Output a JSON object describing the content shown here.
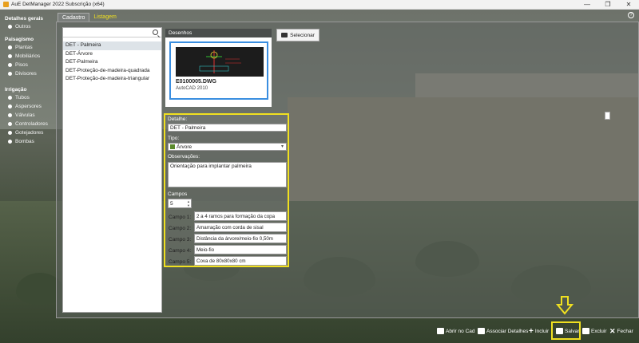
{
  "window": {
    "title": "AuE DetManager 2022 Subscrição (x64)",
    "minimize": "—",
    "maximize": "❐",
    "close": "✕"
  },
  "help": "?",
  "sidebar": {
    "sections": [
      {
        "title": "Detalhes gerais",
        "items": [
          "Outros"
        ]
      },
      {
        "title": "Paisagismo",
        "items": [
          "Plantas",
          "Mobiliários",
          "Pisos",
          "Divisores"
        ]
      },
      {
        "title": "Irrigação",
        "items": [
          "Tubos",
          "Aspersores",
          "Válvulas",
          "Controladores",
          "Gotejadores",
          "Bombas"
        ]
      }
    ],
    "selected": "Plantas"
  },
  "tabs": [
    {
      "label": "Cadastro",
      "active": true
    },
    {
      "label": "Listagem",
      "active": false
    }
  ],
  "list": {
    "items": [
      "DET - Palmeira",
      "DET-Árvore",
      "DET-Palmeira",
      "DET-Proteção-de-madeira-quadrada",
      "DET-Proteção-de-madeira-triangular"
    ],
    "selected_index": 0
  },
  "drawings": {
    "label": "Desenhos",
    "file_name": "E0100005.DWG",
    "file_version": "AutoCAD 2010",
    "select_button": "Selecionar"
  },
  "form": {
    "detalhe_label": "Detalhe:",
    "detalhe_value": "DET - Palmeira",
    "tipo_label": "Tipo:",
    "tipo_value": "Árvore",
    "observacoes_label": "Observações:",
    "observacoes_value": "Orientação para implantar palmeira",
    "campos_label": "Campos",
    "campos_value": "5",
    "campos": [
      {
        "label": "Campo 1:",
        "value": "2 a 4 ramos para formação da copa"
      },
      {
        "label": "Campo 2:",
        "value": "Amarração com corda de sisal"
      },
      {
        "label": "Campo 3:",
        "value": "Distância da árvore/meio-fio 0,50m"
      },
      {
        "label": "Campo 4:",
        "value": "Meio-fio"
      },
      {
        "label": "Campo 5:",
        "value": "Cova de 80x80x80 cm"
      }
    ]
  },
  "bottom_buttons": {
    "abrir": "Abrir no Cad",
    "associar": "Associar Detalhes",
    "incluir": "Incluir",
    "salvar": "Salvar",
    "excluir": "Excluir",
    "fechar": "Fechar"
  },
  "colors": {
    "highlight": "#f0e020",
    "thumb_border": "#3a8ee0",
    "listagem_tab": "#f0e020"
  }
}
